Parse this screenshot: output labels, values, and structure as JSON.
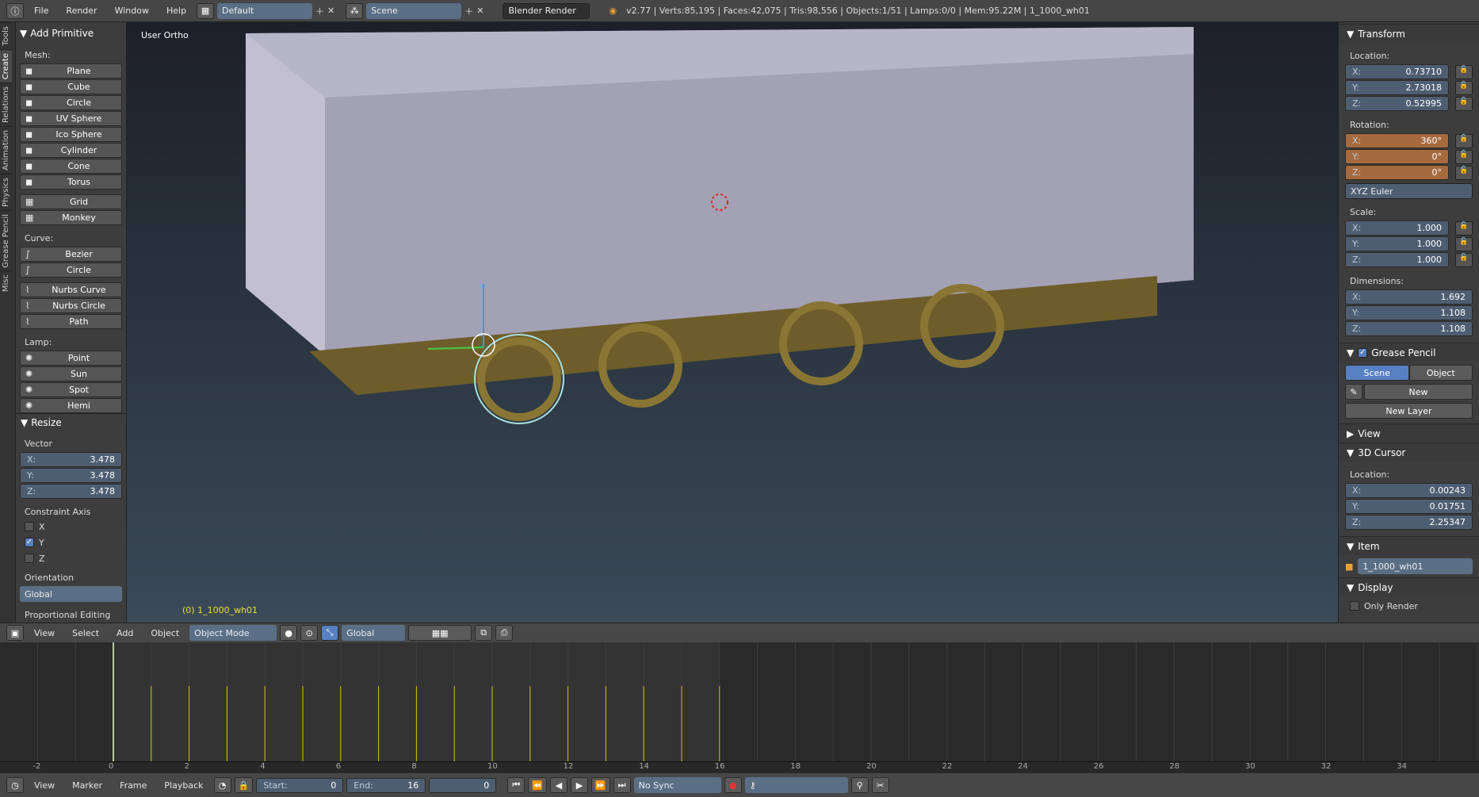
{
  "topbar": {
    "menus": [
      "File",
      "Render",
      "Window",
      "Help"
    ],
    "layout": "Default",
    "scene": "Scene",
    "engine": "Blender Render",
    "stats": "v2.77 | Verts:85,195 | Faces:42,075 | Tris:98,556 | Objects:1/51 | Lamps:0/0 | Mem:95.22M | 1_1000_wh01"
  },
  "tabs": [
    "Tools",
    "Create",
    "Relations",
    "Animation",
    "Physics",
    "Grease Pencil",
    "Misc"
  ],
  "add_primitive": {
    "title": "Add Primitive",
    "mesh_label": "Mesh:",
    "mesh": [
      "Plane",
      "Cube",
      "Circle",
      "UV Sphere",
      "Ico Sphere",
      "Cylinder",
      "Cone",
      "Torus"
    ],
    "mesh2": [
      "Grid",
      "Monkey"
    ],
    "curve_label": "Curve:",
    "curve": [
      "Bezier",
      "Circle"
    ],
    "curve2": [
      "Nurbs Curve",
      "Nurbs Circle",
      "Path"
    ],
    "lamp_label": "Lamp:",
    "lamp": [
      "Point",
      "Sun",
      "Spot",
      "Hemi"
    ]
  },
  "resize": {
    "title": "Resize",
    "vector_label": "Vector",
    "vector": [
      {
        "k": "X:",
        "v": "3.478"
      },
      {
        "k": "Y:",
        "v": "3.478"
      },
      {
        "k": "Z:",
        "v": "3.478"
      }
    ],
    "constraint_label": "Constraint Axis",
    "axes": [
      {
        "k": "X",
        "on": false
      },
      {
        "k": "Y",
        "on": true
      },
      {
        "k": "Z",
        "on": false
      }
    ],
    "orientation_label": "Orientation",
    "orientation": "Global",
    "prop_label": "Proportional Editing"
  },
  "viewport": {
    "view_name": "User Ortho",
    "object_label": "(0) 1_1000_wh01"
  },
  "transform": {
    "title": "Transform",
    "location_label": "Location:",
    "location": [
      {
        "k": "X:",
        "v": "0.73710"
      },
      {
        "k": "Y:",
        "v": "2.73018"
      },
      {
        "k": "Z:",
        "v": "0.52995"
      }
    ],
    "rotation_label": "Rotation:",
    "rotation": [
      {
        "k": "X:",
        "v": "360°"
      },
      {
        "k": "Y:",
        "v": "0°"
      },
      {
        "k": "Z:",
        "v": "0°"
      }
    ],
    "rotation_mode": "XYZ Euler",
    "scale_label": "Scale:",
    "scale": [
      {
        "k": "X:",
        "v": "1.000"
      },
      {
        "k": "Y:",
        "v": "1.000"
      },
      {
        "k": "Z:",
        "v": "1.000"
      }
    ],
    "dimensions_label": "Dimensions:",
    "dimensions": [
      {
        "k": "X:",
        "v": "1.692"
      },
      {
        "k": "Y:",
        "v": "1.108"
      },
      {
        "k": "Z:",
        "v": "1.108"
      }
    ]
  },
  "grease_pencil": {
    "title": "Grease Pencil",
    "scene": "Scene",
    "object": "Object",
    "new": "New",
    "new_layer": "New Layer"
  },
  "view_panel": {
    "title": "View"
  },
  "cursor": {
    "title": "3D Cursor",
    "location_label": "Location:",
    "location": [
      {
        "k": "X:",
        "v": "0.00243"
      },
      {
        "k": "Y:",
        "v": "0.01751"
      },
      {
        "k": "Z:",
        "v": "2.25347"
      }
    ]
  },
  "item": {
    "title": "Item",
    "name": "1_1000_wh01"
  },
  "display": {
    "title": "Display",
    "only_render": "Only Render"
  },
  "header3d": {
    "menus": [
      "View",
      "Select",
      "Add",
      "Object"
    ],
    "mode": "Object Mode",
    "orientation": "Global"
  },
  "timeline": {
    "ticks": [
      "-2",
      "0",
      "2",
      "4",
      "6",
      "8",
      "10",
      "12",
      "14",
      "16",
      "18",
      "20",
      "22",
      "24",
      "26",
      "28",
      "30",
      "32",
      "34"
    ],
    "keyframes": [
      0,
      1,
      2,
      3,
      4,
      5,
      6,
      7,
      8,
      9,
      10,
      11,
      12,
      13,
      14,
      15,
      16
    ],
    "menus": [
      "View",
      "Marker",
      "Frame",
      "Playback"
    ],
    "start_label": "Start:",
    "start": "0",
    "end_label": "End:",
    "end": "16",
    "current": "0",
    "sync": "No Sync"
  }
}
